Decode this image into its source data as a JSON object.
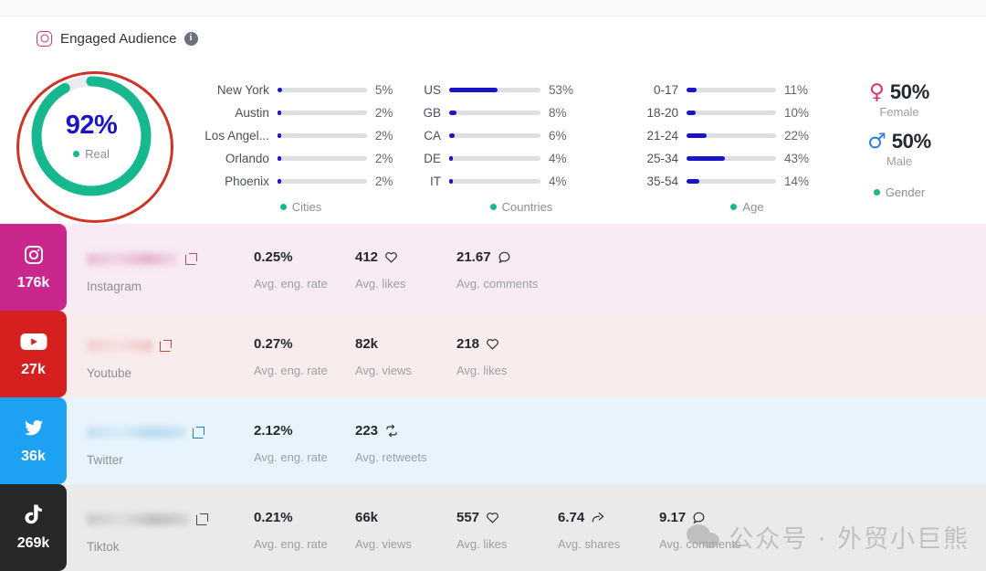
{
  "header": {
    "platform_icon": "instagram-icon",
    "title": "Engaged Audience",
    "info_icon": "info-icon",
    "info_glyph": "i"
  },
  "score": {
    "value": "92%",
    "legend": "Real",
    "annotation": "red-circle-highlight",
    "value_color": "#1a14c9",
    "annotation_color": "#cc3427"
  },
  "cities": {
    "legend": "Cities",
    "items": [
      {
        "label": "New York",
        "pct": "5%",
        "value": 5
      },
      {
        "label": "Austin",
        "pct": "2%",
        "value": 2
      },
      {
        "label": "Los Angel...",
        "pct": "2%",
        "value": 2
      },
      {
        "label": "Orlando",
        "pct": "2%",
        "value": 2
      },
      {
        "label": "Phoenix",
        "pct": "2%",
        "value": 2
      }
    ]
  },
  "countries": {
    "legend": "Countries",
    "items": [
      {
        "label": "US",
        "pct": "53%",
        "value": 53
      },
      {
        "label": "GB",
        "pct": "8%",
        "value": 8
      },
      {
        "label": "CA",
        "pct": "6%",
        "value": 6
      },
      {
        "label": "DE",
        "pct": "4%",
        "value": 4
      },
      {
        "label": "IT",
        "pct": "4%",
        "value": 4
      }
    ]
  },
  "age": {
    "legend": "Age",
    "items": [
      {
        "label": "0-17",
        "pct": "11%",
        "value": 11
      },
      {
        "label": "18-20",
        "pct": "10%",
        "value": 10
      },
      {
        "label": "21-24",
        "pct": "22%",
        "value": 22
      },
      {
        "label": "25-34",
        "pct": "43%",
        "value": 43
      },
      {
        "label": "35-54",
        "pct": "14%",
        "value": 14
      }
    ]
  },
  "gender": {
    "legend": "Gender",
    "female": {
      "symbol": "♀",
      "pct": "50%",
      "label": "Female",
      "color": "#d6336c"
    },
    "male": {
      "symbol": "♂",
      "pct": "50%",
      "label": "Male",
      "color": "#2f7fe0"
    }
  },
  "chart_data": {
    "type": "bar",
    "title": "Engaged Audience",
    "charts": [
      {
        "name": "Cities",
        "categories": [
          "New York",
          "Austin",
          "Los Angel...",
          "Orlando",
          "Phoenix"
        ],
        "values": [
          5,
          2,
          2,
          2,
          2
        ],
        "unit": "%",
        "xlim": [
          0,
          100
        ]
      },
      {
        "name": "Countries",
        "categories": [
          "US",
          "GB",
          "CA",
          "DE",
          "IT"
        ],
        "values": [
          53,
          8,
          6,
          4,
          4
        ],
        "unit": "%",
        "xlim": [
          0,
          100
        ]
      },
      {
        "name": "Age",
        "categories": [
          "0-17",
          "18-20",
          "21-24",
          "25-34",
          "35-54"
        ],
        "values": [
          11,
          10,
          22,
          43,
          14
        ],
        "unit": "%",
        "xlim": [
          0,
          100
        ]
      },
      {
        "name": "Gender",
        "categories": [
          "Female",
          "Male"
        ],
        "values": [
          50,
          50
        ],
        "unit": "%"
      },
      {
        "name": "Real",
        "categories": [
          "Real"
        ],
        "values": [
          92
        ],
        "unit": "%"
      }
    ],
    "grid": false,
    "legend_position": "bottom"
  },
  "platforms": [
    {
      "key": "instagram",
      "icon": "instagram-icon",
      "followers": "176k",
      "name": "Instagram",
      "handle_redacted": true,
      "metrics": [
        {
          "value": "0.25%",
          "label": "Avg. eng. rate",
          "icon": null
        },
        {
          "value": "412",
          "label": "Avg. likes",
          "icon": "heart-icon"
        },
        {
          "value": "21.67",
          "label": "Avg. comments",
          "icon": "comment-icon"
        }
      ]
    },
    {
      "key": "youtube",
      "icon": "youtube-icon",
      "followers": "27k",
      "name": "Youtube",
      "handle_redacted": true,
      "metrics": [
        {
          "value": "0.27%",
          "label": "Avg. eng. rate",
          "icon": null
        },
        {
          "value": "82k",
          "label": "Avg. views",
          "icon": null
        },
        {
          "value": "218",
          "label": "Avg. likes",
          "icon": "heart-icon"
        }
      ]
    },
    {
      "key": "twitter",
      "icon": "twitter-icon",
      "followers": "36k",
      "name": "Twitter",
      "handle_redacted": true,
      "metrics": [
        {
          "value": "2.12%",
          "label": "Avg. eng. rate",
          "icon": null
        },
        {
          "value": "223",
          "label": "Avg. retweets",
          "icon": "retweet-icon"
        }
      ]
    },
    {
      "key": "tiktok",
      "icon": "tiktok-icon",
      "followers": "269k",
      "name": "Tiktok",
      "handle_redacted": true,
      "metrics": [
        {
          "value": "0.21%",
          "label": "Avg. eng. rate",
          "icon": null
        },
        {
          "value": "66k",
          "label": "Avg. views",
          "icon": null
        },
        {
          "value": "557",
          "label": "Avg. likes",
          "icon": "heart-icon"
        },
        {
          "value": "6.74",
          "label": "Avg. shares",
          "icon": "share-icon"
        },
        {
          "value": "9.17",
          "label": "Avg. comments",
          "icon": "comment-icon"
        }
      ]
    }
  ],
  "watermark": {
    "text": "公众号 · 外贸小巨熊",
    "logo": "wechat-icon"
  }
}
